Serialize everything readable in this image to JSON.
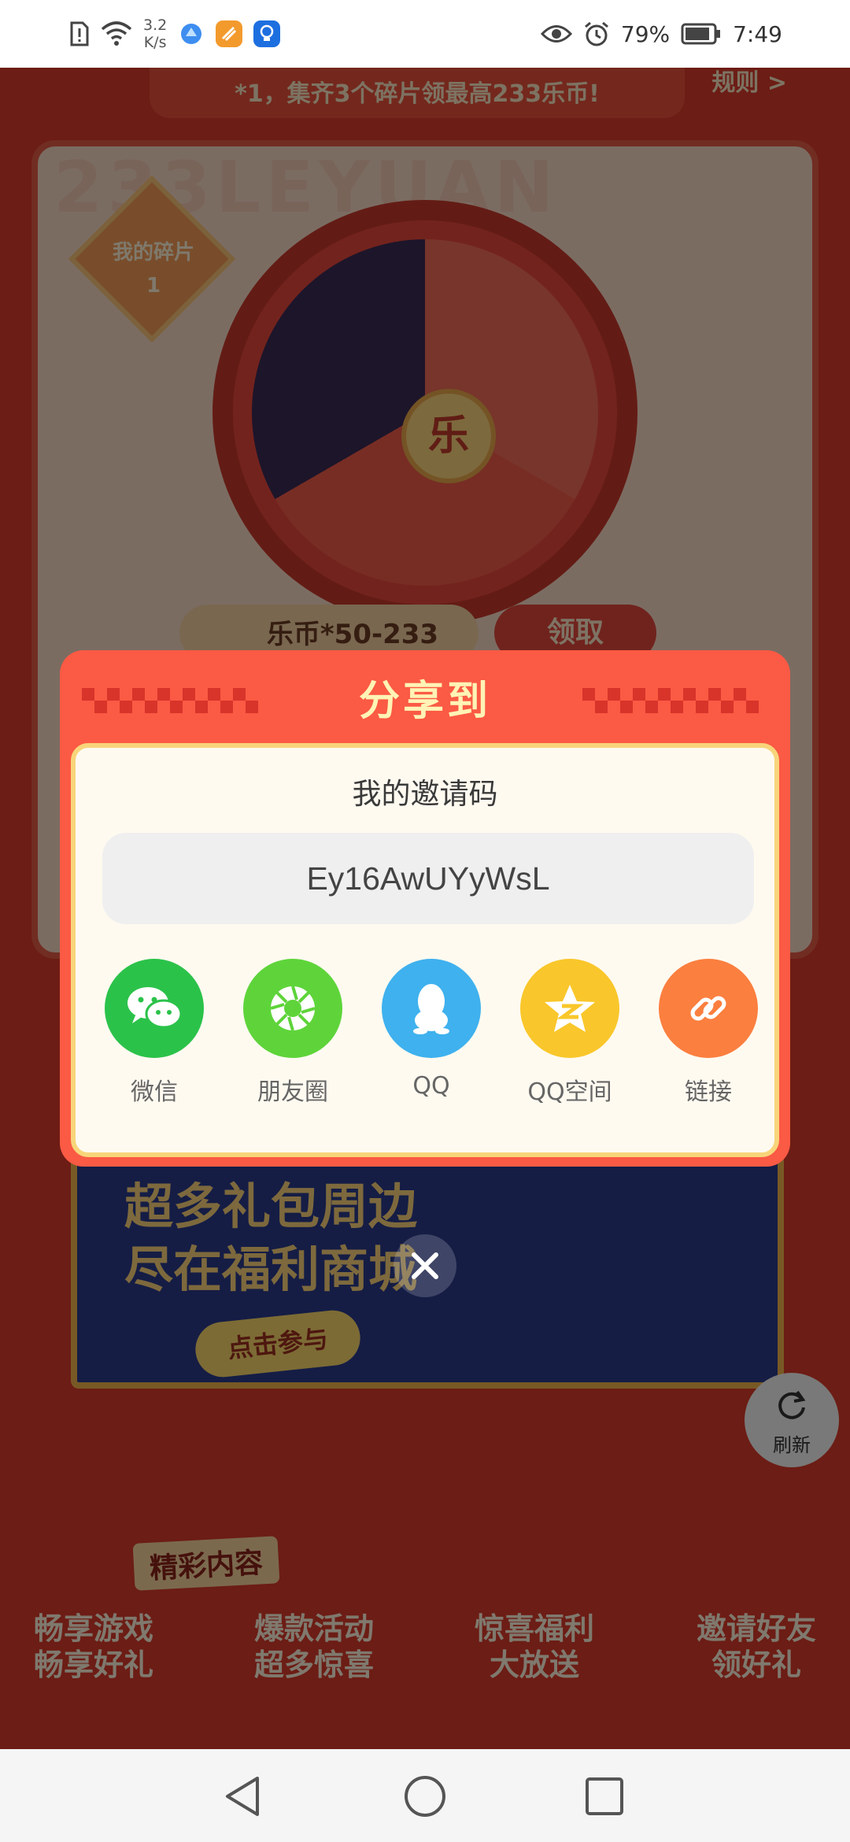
{
  "status_bar": {
    "net_speed_value": "3.2",
    "net_speed_unit": "K/s",
    "battery": "79%",
    "time": "7:49"
  },
  "background_page": {
    "banner_text": "*1，集齐3个碎片领最高233乐币!",
    "rule_link": "规则 >",
    "watermark": "233LEYUAN",
    "fragment_label": "我的碎片",
    "fragment_count": "1",
    "wheel_center": "乐",
    "reward_text": "乐币*50-233",
    "claim_label": "领取",
    "mall_line1": "超多礼包周边",
    "mall_line2": "尽在福利商城",
    "mall_cta": "点击参与",
    "refresh_label": "刷新",
    "section_tag": "精彩内容",
    "features": [
      {
        "line1": "畅享游戏",
        "line2": "畅享好礼"
      },
      {
        "line1": "爆款活动",
        "line2": "超多惊喜"
      },
      {
        "line1": "惊喜福利",
        "line2": "大放送"
      },
      {
        "line1": "邀请好友",
        "line2": "领好礼"
      }
    ]
  },
  "share_modal": {
    "title": "分享到",
    "subtitle": "我的邀请码",
    "invite_code": "Ey16AwUYyWsL",
    "targets": [
      {
        "label": "微信",
        "icon": "wechat-icon",
        "color": "#2bc24a"
      },
      {
        "label": "朋友圈",
        "icon": "moments-icon",
        "color": "#5ed43a"
      },
      {
        "label": "QQ",
        "icon": "qq-icon",
        "color": "#3fb1ee"
      },
      {
        "label": "QQ空间",
        "icon": "qzone-icon",
        "color": "#f9c72b"
      },
      {
        "label": "链接",
        "icon": "link-icon",
        "color": "#fb7f3f"
      }
    ]
  },
  "colors": {
    "modal_header": "#fb5a44",
    "modal_body": "#fffaf0",
    "modal_title": "#fff3b5"
  }
}
